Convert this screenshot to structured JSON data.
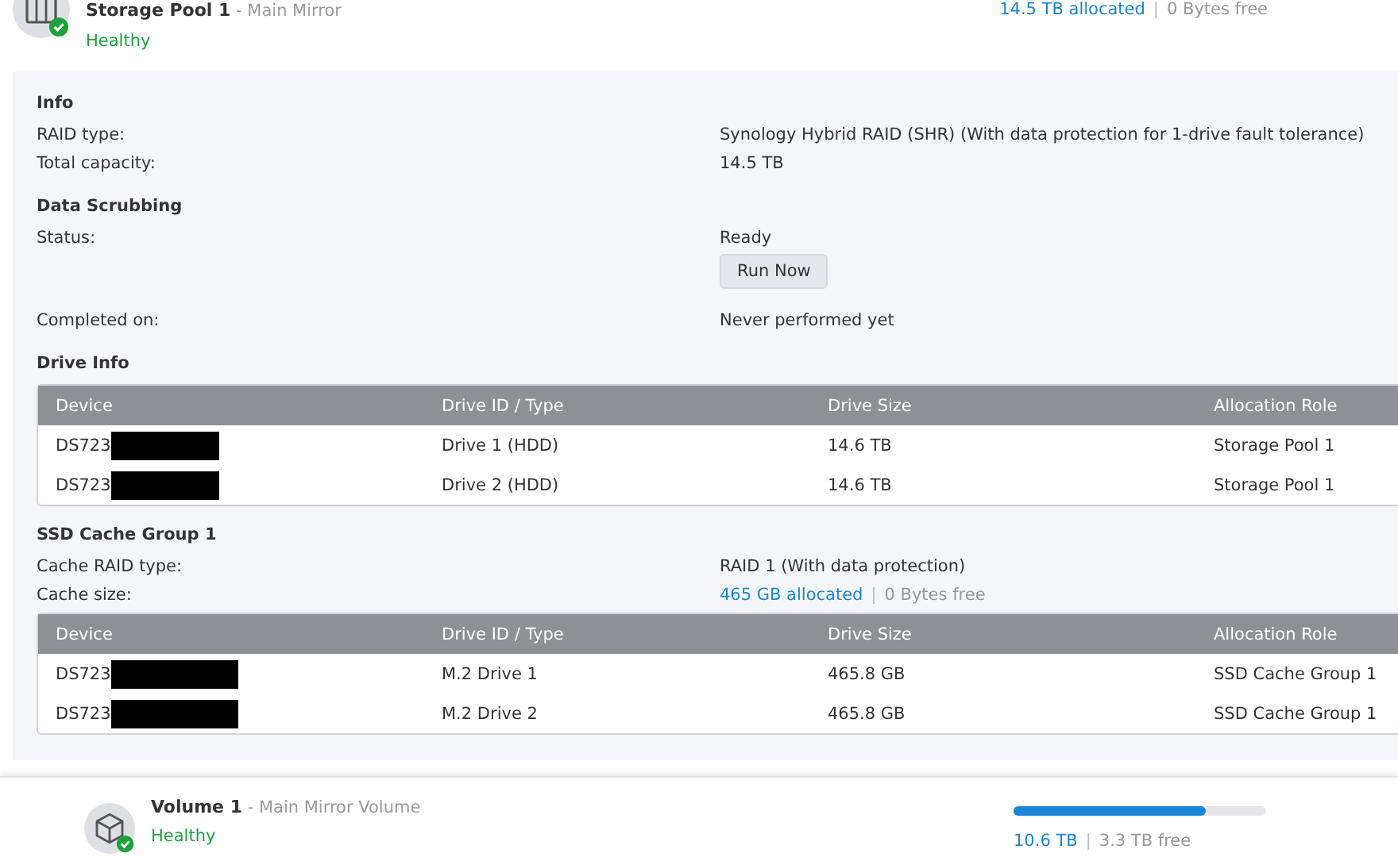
{
  "pool": {
    "name": "Storage Pool 1",
    "subtitle": "- Main Mirror",
    "status": "Healthy",
    "allocated": "14.5 TB allocated",
    "separator": "|",
    "free": "0 Bytes free"
  },
  "info": {
    "title": "Info",
    "rows": [
      {
        "label": "RAID type:",
        "value": "Synology Hybrid RAID (SHR) (With data protection for 1-drive fault tolerance)"
      },
      {
        "label": "Total capacity:",
        "value": "14.5 TB"
      }
    ]
  },
  "scrubbing": {
    "title": "Data Scrubbing",
    "status_label": "Status:",
    "status_value": "Ready",
    "button": "Run Now",
    "completed_label": "Completed on:",
    "completed_value": "Never performed yet"
  },
  "drive_info": {
    "title": "Drive Info",
    "columns": [
      "Device",
      "Drive ID / Type",
      "Drive Size",
      "Allocation Role"
    ],
    "rows": [
      {
        "device": "DS723",
        "redacted": true,
        "id": "Drive 1 (HDD)",
        "size": "14.6 TB",
        "role": "Storage Pool 1"
      },
      {
        "device": "DS723",
        "redacted": true,
        "id": "Drive 2 (HDD)",
        "size": "14.6 TB",
        "role": "Storage Pool 1"
      }
    ]
  },
  "ssd_cache": {
    "title": "SSD Cache Group 1",
    "raid_label": "Cache RAID type:",
    "raid_value": "RAID 1 (With data protection)",
    "size_label": "Cache size:",
    "allocated": "465 GB allocated",
    "separator": "|",
    "free": "0 Bytes free",
    "columns": [
      "Device",
      "Drive ID / Type",
      "Drive Size",
      "Allocation Role"
    ],
    "rows": [
      {
        "device": "DS723",
        "redacted": true,
        "id": "M.2 Drive 1",
        "size": "465.8 GB",
        "role": "SSD Cache Group 1"
      },
      {
        "device": "DS723",
        "redacted": true,
        "id": "M.2 Drive 2",
        "size": "465.8 GB",
        "role": "SSD Cache Group 1"
      }
    ]
  },
  "volume": {
    "name": "Volume 1",
    "subtitle": "- Main Mirror Volume",
    "status": "Healthy",
    "level": 0.76,
    "used": "10.6 TB",
    "separator": "|",
    "free": "3.3 TB free"
  }
}
